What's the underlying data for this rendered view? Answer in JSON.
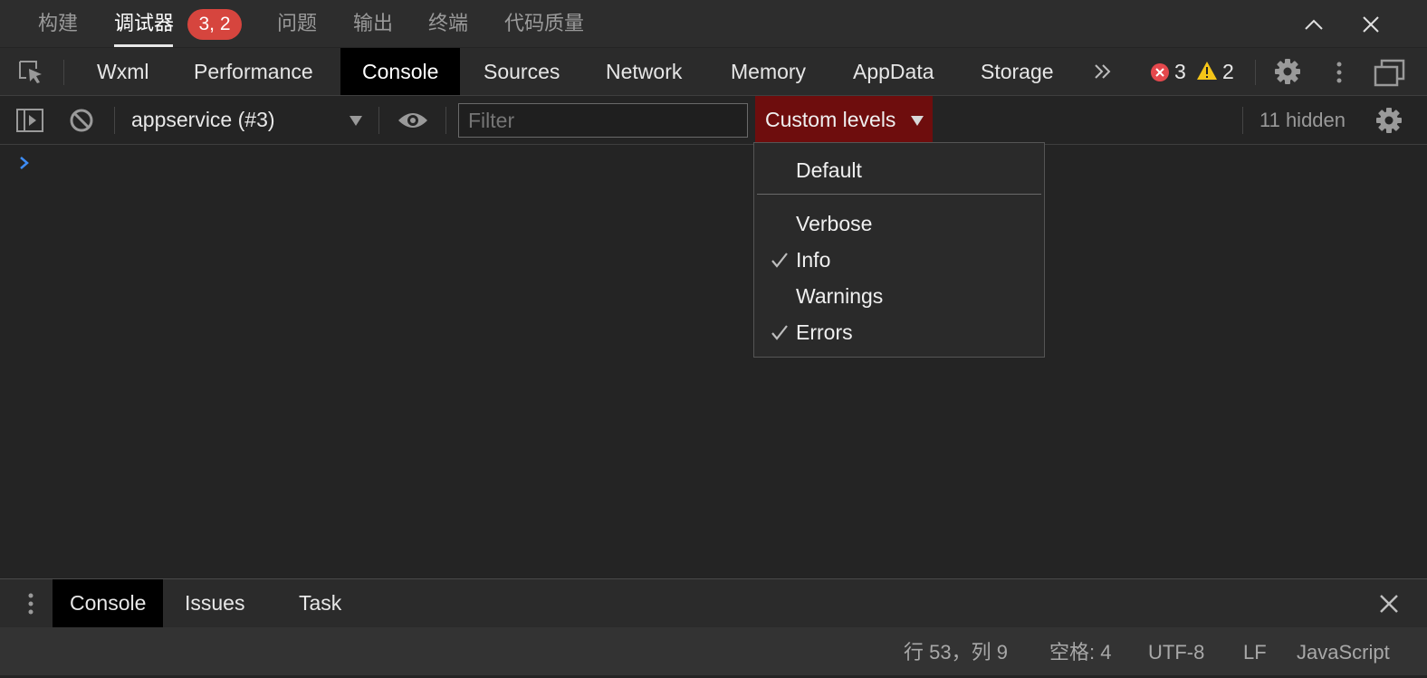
{
  "topbar": {
    "tabs": [
      {
        "label": "构建"
      },
      {
        "label": "调试器"
      },
      {
        "label": "问题"
      },
      {
        "label": "输出"
      },
      {
        "label": "终端"
      },
      {
        "label": "代码质量"
      }
    ],
    "badge": "3, 2",
    "buttons": {
      "collapse": "chevron-up-icon",
      "close": "close-icon"
    }
  },
  "devtools": {
    "tabs": [
      {
        "label": "Wxml"
      },
      {
        "label": "Performance"
      },
      {
        "label": "Console"
      },
      {
        "label": "Sources"
      },
      {
        "label": "Network"
      },
      {
        "label": "Memory"
      },
      {
        "label": "AppData"
      },
      {
        "label": "Storage"
      }
    ],
    "active_tab": "Console",
    "error_count": "3",
    "warning_count": "2"
  },
  "console_toolbar": {
    "context": "appservice (#3)",
    "filter_placeholder": "Filter",
    "levels_label": "Custom levels",
    "hidden_count": "11 hidden"
  },
  "levels_menu": {
    "default_label": "Default",
    "items": [
      {
        "label": "Verbose",
        "checked": false
      },
      {
        "label": "Info",
        "checked": true
      },
      {
        "label": "Warnings",
        "checked": false
      },
      {
        "label": "Errors",
        "checked": true
      }
    ]
  },
  "drawer": {
    "tabs": [
      {
        "label": "Console"
      },
      {
        "label": "Issues"
      },
      {
        "label": "Task"
      }
    ],
    "active_tab": "Console"
  },
  "statusbar": {
    "position": "行 53，列 9",
    "indent": "空格: 4",
    "encoding": "UTF-8",
    "eol": "LF",
    "language": "JavaScript"
  },
  "colors": {
    "accent_red": "#d6453e",
    "levels_bg": "#6e0d0d",
    "warning_yellow": "#f5c518",
    "prompt_blue": "#3d8cf5"
  }
}
